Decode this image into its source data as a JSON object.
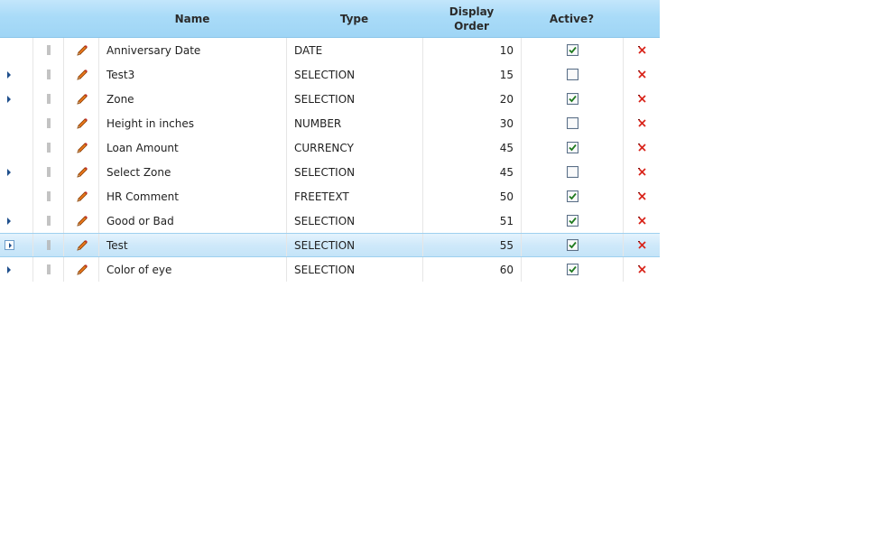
{
  "columns": {
    "name": "Name",
    "type": "Type",
    "display_order_line1": "Display",
    "display_order_line2": "Order",
    "active": "Active?"
  },
  "colors": {
    "header_bg": "#a9dbf8",
    "selected_row_bg": "#cfe9fa",
    "delete_red": "#d9261c",
    "pencil_orange": "#e8761b",
    "check_green": "#1f7a1f"
  },
  "icons": {
    "drag": "drag-grip-icon",
    "edit": "pencil-icon",
    "delete": "delete-x-icon",
    "expand": "expand-arrow-icon"
  },
  "rows": [
    {
      "name": "Anniversary Date",
      "type": "DATE",
      "order": "10",
      "active": true,
      "expandable": false,
      "selected": false
    },
    {
      "name": "Test3",
      "type": "SELECTION",
      "order": "15",
      "active": false,
      "expandable": true,
      "selected": false
    },
    {
      "name": "Zone",
      "type": "SELECTION",
      "order": "20",
      "active": true,
      "expandable": true,
      "selected": false
    },
    {
      "name": "Height in inches",
      "type": "NUMBER",
      "order": "30",
      "active": false,
      "expandable": false,
      "selected": false
    },
    {
      "name": "Loan Amount",
      "type": "CURRENCY",
      "order": "45",
      "active": true,
      "expandable": false,
      "selected": false
    },
    {
      "name": "Select Zone",
      "type": "SELECTION",
      "order": "45",
      "active": false,
      "expandable": true,
      "selected": false
    },
    {
      "name": "HR Comment",
      "type": "FREETEXT",
      "order": "50",
      "active": true,
      "expandable": false,
      "selected": false
    },
    {
      "name": "Good or Bad",
      "type": "SELECTION",
      "order": "51",
      "active": true,
      "expandable": true,
      "selected": false
    },
    {
      "name": "Test",
      "type": "SELECTION",
      "order": "55",
      "active": true,
      "expandable": true,
      "selected": true
    },
    {
      "name": "Color of eye",
      "type": "SELECTION",
      "order": "60",
      "active": true,
      "expandable": true,
      "selected": false
    }
  ]
}
